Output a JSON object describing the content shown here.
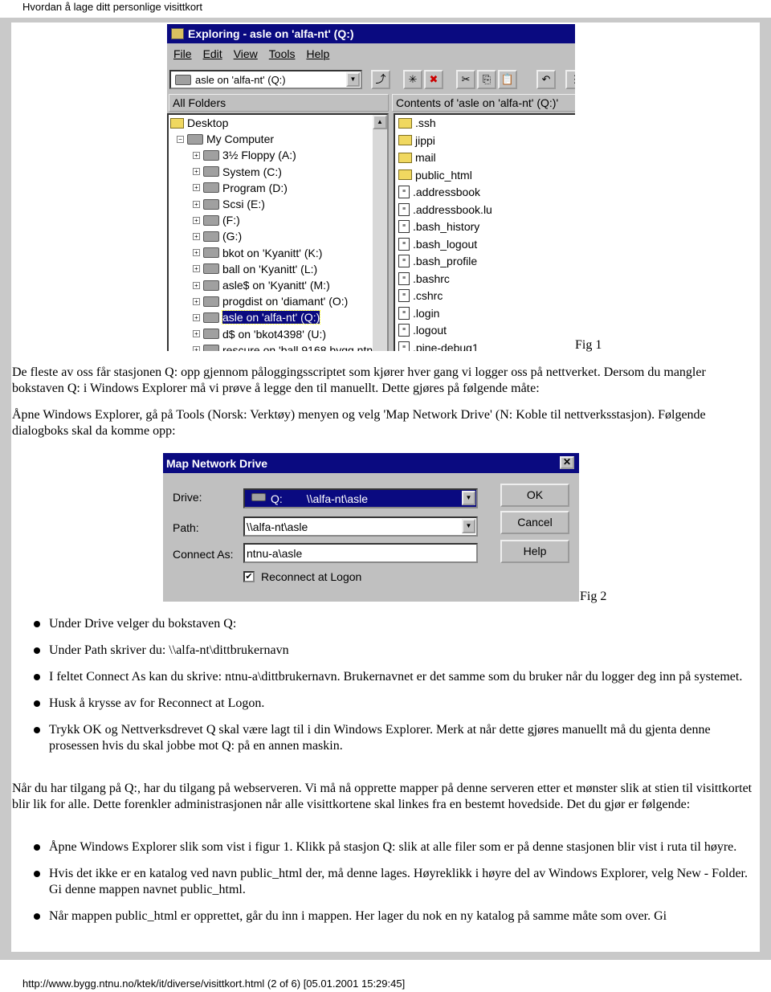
{
  "header": "Hvordan å lage ditt personlige visittkort",
  "footer": "http://www.bygg.ntnu.no/ktek/it/diverse/visittkort.html (2 of 6) [05.01.2001 15:29:45]",
  "explorer": {
    "title": "Exploring - asle on 'alfa-nt' (Q:)",
    "menu": [
      "File",
      "Edit",
      "View",
      "Tools",
      "Help"
    ],
    "address": "asle on 'alfa-nt' (Q:)",
    "all_folders": "All Folders",
    "contents": "Contents of 'asle on 'alfa-nt' (Q:)'",
    "tree": [
      "Desktop",
      "My Computer",
      "3½ Floppy (A:)",
      "System (C:)",
      "Program (D:)",
      "Scsi (E:)",
      "(F:)",
      "(G:)",
      "bkot on 'Kyanitt' (K:)",
      "ball on 'Kyanitt' (L:)",
      "asle$ on 'Kyanitt' (M:)",
      "progdist on 'diamant' (O:)",
      "asle on 'alfa-nt' (Q:)",
      "d$ on 'bkot4398' (U:)",
      "rescure on 'ball 9168 bygg.ntn"
    ],
    "selected_tree_item": "asle on 'alfa-nt' (Q:)",
    "folders": [
      ".ssh",
      "jippi",
      "mail",
      "public_html"
    ],
    "files": [
      ".addressbook",
      ".addressbook.lu",
      ".bash_history",
      ".bash_logout",
      ".bash_profile",
      ".bashrc",
      ".cshrc",
      ".login",
      ".logout",
      ".pine-debug1"
    ]
  },
  "fig1": "Fig 1",
  "p1": "De fleste av oss får stasjonen Q: opp gjennom påloggingsscriptet som kjører hver gang vi logger oss på nettverket. Dersom du mangler bokstaven Q: i Windows Explorer må vi prøve å legge den til manuellt. Dette gjøres på følgende måte:",
  "p2": "Åpne Windows Explorer, gå på Tools (Norsk: Verktøy) menyen og velg 'Map Network Drive' (N: Koble til nettverksstasjon). Følgende dialogboks skal da komme opp:",
  "dialog": {
    "title": "Map Network Drive",
    "drive_label": "Drive:",
    "drive_letter": "Q:",
    "drive_value": "\\\\alfa-nt\\asle",
    "path_label": "Path:",
    "path_value": "\\\\alfa-nt\\asle",
    "connect_label": "Connect As:",
    "connect_value": "ntnu-a\\asle",
    "reconnect_label": "Reconnect at Logon",
    "reconnect_checked": true,
    "ok": "OK",
    "cancel": "Cancel",
    "help": "Help"
  },
  "fig2": "Fig 2",
  "list1": [
    "Under Drive velger du bokstaven Q:",
    "Under Path skriver du: \\\\alfa-nt\\dittbrukernavn",
    "I feltet Connect As kan du skrive: ntnu-a\\dittbrukernavn. Brukernavnet er det samme som du bruker når du logger deg inn på systemet.",
    "Husk å krysse av for Reconnect at Logon.",
    "Trykk OK og Nettverksdrevet Q skal være lagt til i din Windows Explorer. Merk at når dette gjøres manuellt må du gjenta denne prosessen hvis du skal jobbe mot Q: på en annen maskin."
  ],
  "p3": "Når du har tilgang på Q:, har du tilgang på webserveren. Vi må nå opprette mapper på denne serveren etter et mønster slik at stien til visittkortet blir lik for alle. Dette forenkler administrasjonen når alle visittkortene skal linkes fra en bestemt hovedside. Det du gjør er følgende:",
  "list2": [
    "Åpne Windows Explorer slik som vist i figur 1. Klikk på stasjon Q: slik at alle filer som er på denne stasjonen blir vist i ruta til høyre.",
    "Hvis det ikke er en katalog ved navn public_html der,  må denne lages. Høyreklikk i høyre del av Windows Explorer, velg New - Folder. Gi denne mappen navnet public_html.",
    "Når mappen public_html er opprettet, går du inn i mappen. Her lager du nok en ny katalog på samme måte som over. Gi"
  ]
}
